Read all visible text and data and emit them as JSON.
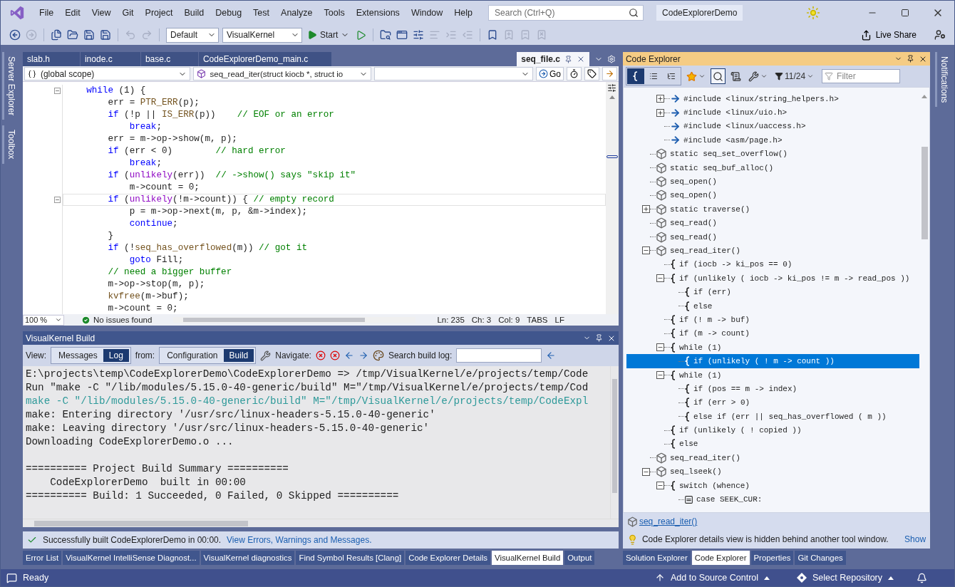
{
  "title_bar": {
    "menu": [
      "File",
      "Edit",
      "View",
      "Git",
      "Project",
      "Build",
      "Debug",
      "Test",
      "Analyze",
      "Tools",
      "Extensions",
      "Window",
      "Help"
    ],
    "search": {
      "placeholder": "Search (Ctrl+Q)"
    },
    "solution_name": "CodeExplorerDemo"
  },
  "toolbar": {
    "left_buttons": [
      {
        "disabled": false
      },
      {
        "disabled": true
      },
      {
        "disabled": false
      },
      {
        "disabled": false
      },
      {
        "disabled": false
      },
      {
        "disabled": false
      },
      {
        "disabled": true
      },
      {
        "disabled": true
      }
    ],
    "configuration": "Default",
    "platform": "VisualKernel",
    "start": "Start",
    "right_buttons": [
      {
        "disabled": false
      },
      {
        "disabled": false
      },
      {
        "disabled": false
      },
      {
        "disabled": true
      },
      {
        "disabled": true
      },
      {
        "disabled": true
      },
      {
        "disabled": false
      },
      {
        "disabled": true
      },
      {
        "disabled": true
      },
      {
        "disabled": true
      }
    ],
    "live_share": "Live Share"
  },
  "left_strip": [
    "Server Explorer",
    "Toolbox"
  ],
  "right_strip": [
    "Notifications"
  ],
  "editor": {
    "tabs": [
      {
        "label": "slab.h",
        "selected": false
      },
      {
        "label": "inode.c",
        "selected": false
      },
      {
        "label": "base.c",
        "selected": false
      },
      {
        "label": "CodeExplorerDemo_main.c",
        "selected": false
      },
      {
        "label": "seq_file.c",
        "selected": true
      }
    ],
    "scope": "(global scope)",
    "member": "seq_read_iter(struct kiocb *, struct io",
    "go": "Go",
    "lines": [
      {
        "foldable": true,
        "current": false,
        "tokens": [
          {
            "text": "    while",
            "kind": "keyword"
          },
          {
            "text": " (1) {",
            "kind": "plain"
          }
        ]
      },
      {
        "foldable": false,
        "current": false,
        "tokens": [
          {
            "text": "        err = ",
            "kind": "plain"
          },
          {
            "text": "PTR_ERR",
            "kind": "func"
          },
          {
            "text": "(p);",
            "kind": "plain"
          }
        ]
      },
      {
        "foldable": false,
        "current": false,
        "tokens": [
          {
            "text": "        if",
            "kind": "keyword"
          },
          {
            "text": " (!p || ",
            "kind": "plain"
          },
          {
            "text": "IS_ERR",
            "kind": "func"
          },
          {
            "text": "(p))    ",
            "kind": "plain"
          },
          {
            "text": "// EOF or an error",
            "kind": "comment"
          }
        ]
      },
      {
        "foldable": false,
        "current": false,
        "tokens": [
          {
            "text": "            break",
            "kind": "keyword"
          },
          {
            "text": ";",
            "kind": "plain"
          }
        ]
      },
      {
        "foldable": false,
        "current": false,
        "tokens": [
          {
            "text": "        err = m->op->show(m, p);",
            "kind": "plain"
          }
        ]
      },
      {
        "foldable": false,
        "current": false,
        "tokens": [
          {
            "text": "        if",
            "kind": "keyword"
          },
          {
            "text": " (err < 0)        ",
            "kind": "plain"
          },
          {
            "text": "// hard error",
            "kind": "comment"
          }
        ]
      },
      {
        "foldable": false,
        "current": false,
        "tokens": [
          {
            "text": "            break",
            "kind": "keyword"
          },
          {
            "text": ";",
            "kind": "plain"
          }
        ]
      },
      {
        "foldable": false,
        "current": false,
        "tokens": [
          {
            "text": "        if",
            "kind": "keyword"
          },
          {
            "text": " (",
            "kind": "plain"
          },
          {
            "text": "unlikely",
            "kind": "macro"
          },
          {
            "text": "(err))  ",
            "kind": "plain"
          },
          {
            "text": "// ->show() says \"skip it\"",
            "kind": "comment"
          }
        ]
      },
      {
        "foldable": false,
        "current": false,
        "tokens": [
          {
            "text": "            m->count = 0;",
            "kind": "plain"
          }
        ]
      },
      {
        "foldable": true,
        "current": true,
        "tokens": [
          {
            "text": "        if",
            "kind": "keyword"
          },
          {
            "text": " (",
            "kind": "plain"
          },
          {
            "text": "unlikely",
            "kind": "macro"
          },
          {
            "text": "(!m->count)) { ",
            "kind": "plain"
          },
          {
            "text": "// empty record",
            "kind": "comment"
          }
        ]
      },
      {
        "foldable": false,
        "current": false,
        "tokens": [
          {
            "text": "            p = m->op->next(m, p, &m->index);",
            "kind": "plain"
          }
        ]
      },
      {
        "foldable": false,
        "current": false,
        "tokens": [
          {
            "text": "            continue",
            "kind": "keyword"
          },
          {
            "text": ";",
            "kind": "plain"
          }
        ]
      },
      {
        "foldable": false,
        "current": false,
        "tokens": [
          {
            "text": "        }",
            "kind": "plain"
          }
        ]
      },
      {
        "foldable": false,
        "current": false,
        "tokens": [
          {
            "text": "        if",
            "kind": "keyword"
          },
          {
            "text": " (!",
            "kind": "plain"
          },
          {
            "text": "seq_has_overflowed",
            "kind": "func"
          },
          {
            "text": "(m)) ",
            "kind": "plain"
          },
          {
            "text": "// got it",
            "kind": "comment"
          }
        ]
      },
      {
        "foldable": false,
        "current": false,
        "tokens": [
          {
            "text": "            goto",
            "kind": "keyword"
          },
          {
            "text": " Fill;",
            "kind": "plain"
          }
        ]
      },
      {
        "foldable": false,
        "current": false,
        "tokens": [
          {
            "text": "        // need a bigger buffer",
            "kind": "comment"
          }
        ]
      },
      {
        "foldable": false,
        "current": false,
        "tokens": [
          {
            "text": "        m->op->stop(m, p);",
            "kind": "plain"
          }
        ]
      },
      {
        "foldable": false,
        "current": false,
        "tokens": [
          {
            "text": "        kvfree",
            "kind": "func"
          },
          {
            "text": "(m->buf);",
            "kind": "plain"
          }
        ]
      },
      {
        "foldable": false,
        "current": false,
        "tokens": [
          {
            "text": "        m->count = 0;",
            "kind": "plain"
          }
        ]
      }
    ],
    "status": {
      "zoom": "100 %",
      "issues": "No issues found",
      "line": "Ln: 235",
      "char": "Ch: 3",
      "col": "Col: 9",
      "indent": "TABS",
      "eol": "LF"
    }
  },
  "build": {
    "title": "VisualKernel Build",
    "view_label": "View:",
    "view_options": [
      {
        "label": "Messages",
        "selected": false
      },
      {
        "label": "Log",
        "selected": true
      }
    ],
    "from_label": "from:",
    "from_options": [
      {
        "label": "Configuration",
        "selected": false
      },
      {
        "label": "Build",
        "selected": true
      }
    ],
    "navigate_label": "Navigate:",
    "search_label": "Search build log:",
    "log": [
      {
        "text": "E:\\projects\\temp\\CodeExplorerDemo\\CodeExplorerDemo => /tmp/VisualKernel/e/projects/temp/Code",
        "kind": "plain"
      },
      {
        "text": "Run \"make -C \"/lib/modules/5.15.0-40-generic/build\" M=\"/tmp/VisualKernel/e/projects/temp/Cod",
        "kind": "plain"
      },
      {
        "text": "make -C \"/lib/modules/5.15.0-40-generic/build\" M=\"/tmp/VisualKernel/e/projects/temp/CodeExpl",
        "kind": "command"
      },
      {
        "text": "make: Entering directory '/usr/src/linux-headers-5.15.0-40-generic'",
        "kind": "plain"
      },
      {
        "text": "make: Leaving directory '/usr/src/linux-headers-5.15.0-40-generic'",
        "kind": "plain"
      },
      {
        "text": "Downloading CodeExplorerDemo.o ...",
        "kind": "plain"
      }
    ],
    "summary": [
      "========== Project Build Summary ==========",
      "    CodeExplorerDemo  built in 00:00",
      "========== Build: 1 Succeeded, 0 Failed, 0 Skipped =========="
    ],
    "result": "Successfully built CodeExplorerDemo in 00:00.",
    "result_link": "View Errors, Warnings and Messages.",
    "tabs": [
      {
        "label": "Error List",
        "selected": false
      },
      {
        "label": "VisualKernel IntelliSense Diagnost...",
        "selected": false
      },
      {
        "label": "VisualKernel diagnostics",
        "selected": false
      },
      {
        "label": "Find Symbol Results [Clang]",
        "selected": false
      },
      {
        "label": "Code Explorer Details",
        "selected": false
      },
      {
        "label": "VisualKernel Build",
        "selected": true
      },
      {
        "label": "Output",
        "selected": false
      }
    ]
  },
  "code_explorer": {
    "title": "Code Explorer",
    "view_modes": [
      {
        "selected": true
      },
      {
        "selected": false
      },
      {
        "selected": false
      }
    ],
    "search_active": true,
    "filter_count": "11/24",
    "filter": {
      "placeholder": "Filter"
    },
    "tree": [
      {
        "kind": "group",
        "children": [
          {
            "kind": "include",
            "label": "#include <linux/string_helpers.h>",
            "expanded": false,
            "selected": false
          },
          {
            "kind": "include",
            "label": "#include <linux/uio.h>",
            "expanded": false,
            "selected": false
          },
          {
            "kind": "include",
            "label": "#include <linux/uaccess.h>",
            "selected": false
          },
          {
            "kind": "include",
            "label": "#include <asm/page.h>",
            "selected": false
          }
        ]
      },
      {
        "kind": "function",
        "label": "static seq_set_overflow()",
        "selected": false
      },
      {
        "kind": "function",
        "label": "static seq_buf_alloc()",
        "selected": false
      },
      {
        "kind": "function",
        "label": "seq_open()",
        "selected": false
      },
      {
        "kind": "function",
        "label": "seq_open()",
        "selected": false
      },
      {
        "kind": "function",
        "label": "static traverse()",
        "expanded": false,
        "selected": false
      },
      {
        "kind": "function",
        "label": "seq_read()",
        "selected": false
      },
      {
        "kind": "function",
        "label": "seq_read()",
        "selected": false
      },
      {
        "kind": "function",
        "label": "seq_read_iter()",
        "expanded": true,
        "selected": false,
        "children": [
          {
            "kind": "block",
            "label": "if (iocb -> ki_pos == 0)",
            "selected": false
          },
          {
            "kind": "block",
            "label": "if (unlikely ( iocb -> ki_pos != m -> read_pos ))",
            "expanded": true,
            "selected": false,
            "children": [
              {
                "kind": "block",
                "label": "if (err)",
                "selected": false
              },
              {
                "kind": "block",
                "label": "else",
                "selected": false
              }
            ]
          },
          {
            "kind": "block",
            "label": "if (! m -> buf)",
            "selected": false
          },
          {
            "kind": "block",
            "label": "if (m -> count)",
            "selected": false
          },
          {
            "kind": "block",
            "label": "while (1)",
            "expanded": true,
            "selected": false,
            "children": [
              {
                "kind": "block",
                "label": "if (unlikely ( ! m -> count ))",
                "selected": true
              }
            ]
          },
          {
            "kind": "block",
            "label": "while (1)",
            "expanded": true,
            "selected": false,
            "children": [
              {
                "kind": "block",
                "label": "if (pos == m -> index)",
                "selected": false
              },
              {
                "kind": "block",
                "label": "if (err > 0)",
                "selected": false
              },
              {
                "kind": "block",
                "label": "else if (err || seq_has_overflowed ( m ))",
                "selected": false
              }
            ]
          },
          {
            "kind": "block",
            "label": "if (unlikely ( ! copied ))",
            "selected": false
          },
          {
            "kind": "block",
            "label": "else",
            "selected": false
          }
        ]
      },
      {
        "kind": "function",
        "label": "seq_read_iter()",
        "selected": false
      },
      {
        "kind": "function",
        "label": "seq_lseek()",
        "expanded": true,
        "selected": false,
        "children": [
          {
            "kind": "block",
            "label": "switch (whence)",
            "expanded": true,
            "selected": false,
            "children": [
              {
                "kind": "case",
                "label": "case SEEK_CUR:",
                "selected": false
              }
            ]
          }
        ]
      }
    ],
    "current_symbol": "seq_read_iter()",
    "notice": "Code Explorer details view is hidden behind another tool window.",
    "notice_action": "Show",
    "tabs": [
      {
        "label": "Solution Explorer",
        "selected": false
      },
      {
        "label": "Code Explorer",
        "selected": true
      },
      {
        "label": "Properties",
        "selected": false
      },
      {
        "label": "Git Changes",
        "selected": false
      }
    ]
  },
  "status_bar": {
    "message": "Ready",
    "source_control": "Add to Source Control",
    "repository": "Select Repository"
  }
}
